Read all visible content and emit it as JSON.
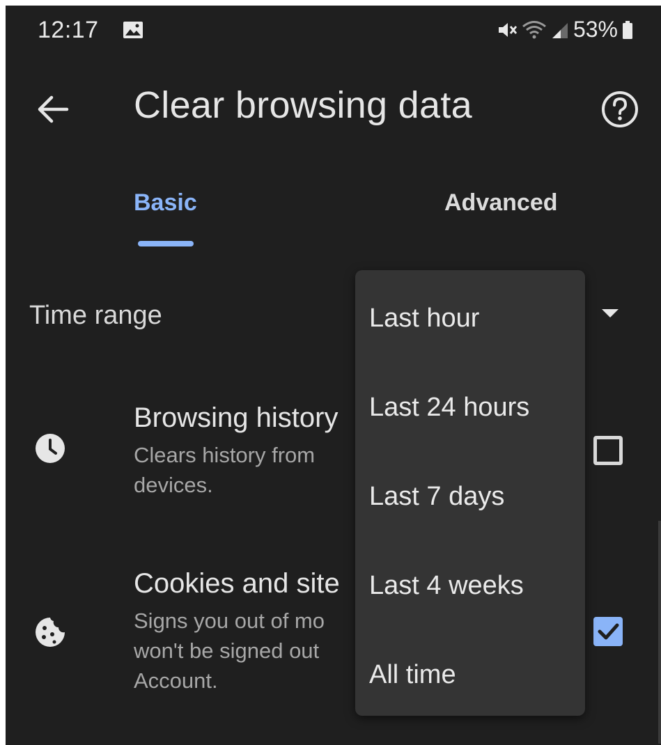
{
  "status_bar": {
    "time": "12:17",
    "battery": "53%",
    "icons": [
      "image-notification-icon",
      "mute-icon",
      "wifi-icon",
      "signal-icon",
      "battery-icon"
    ]
  },
  "app_bar": {
    "title": "Clear browsing data",
    "icons": [
      "back-arrow-icon",
      "help-icon"
    ]
  },
  "tabs": [
    {
      "label": "Basic",
      "selected": true
    },
    {
      "label": "Advanced",
      "selected": false
    }
  ],
  "time_range": {
    "label": "Time range",
    "options": [
      "Last hour",
      "Last 24 hours",
      "Last 7 days",
      "Last 4 weeks",
      "All time"
    ]
  },
  "items": [
    {
      "title": "Browsing history",
      "desc_line1": "Clears history from",
      "desc_line2": "devices.",
      "icon": "clock-icon",
      "checked": false
    },
    {
      "title": "Cookies and site",
      "desc_line1": "Signs you out of mo",
      "desc_line2": "won't be signed out",
      "desc_line3": "Account.",
      "icon": "cookie-icon",
      "checked": true
    }
  ],
  "colors": {
    "background": "#1f1f1f",
    "accent": "#8ab4f8",
    "menu_background": "#343434",
    "text_primary": "#e6e6e6",
    "text_secondary": "#a7a7a7"
  }
}
